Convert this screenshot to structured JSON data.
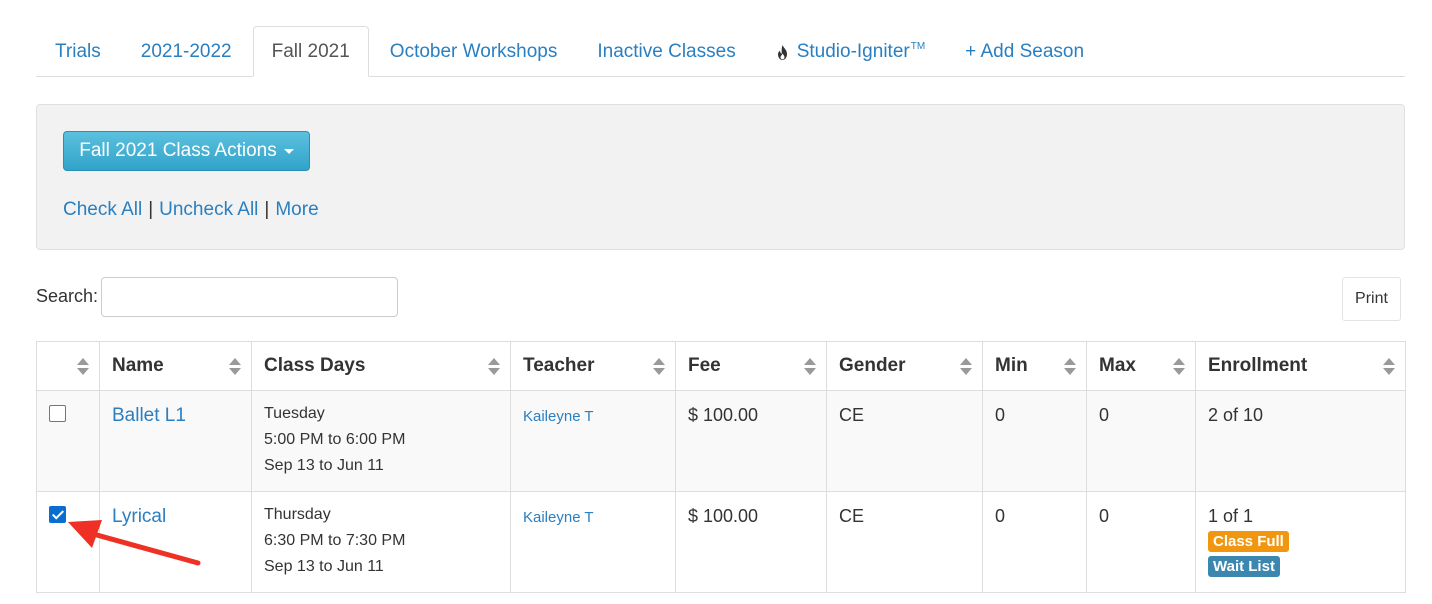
{
  "tabs": [
    {
      "label": "Trials"
    },
    {
      "label": "2021-2022"
    },
    {
      "label": "Fall 2021",
      "active": true
    },
    {
      "label": "October Workshops"
    },
    {
      "label": "Inactive Classes"
    },
    {
      "label": "Studio-Igniter",
      "icon": "flame-icon",
      "trademark": "TM"
    },
    {
      "label": "+ Add Season"
    }
  ],
  "actions": {
    "button_label": "Fall 2021 Class Actions",
    "check_all": "Check All",
    "separator": "|",
    "uncheck_all": "Uncheck All",
    "more": "More"
  },
  "search": {
    "label": "Search:",
    "value": ""
  },
  "print_label": "Print",
  "table": {
    "headers": [
      "",
      "Name",
      "Class Days",
      "Teacher",
      "Fee",
      "Gender",
      "Min",
      "Max",
      "Enrollment"
    ],
    "rows": [
      {
        "checked": false,
        "name": "Ballet L1",
        "day": "Tuesday",
        "time": "5:00 PM to 6:00 PM",
        "dates": "Sep 13 to Jun 11",
        "teacher": "Kaileyne T",
        "fee": "$ 100.00",
        "gender": "CE",
        "min": "0",
        "max": "0",
        "enrollment": "2 of 10",
        "badges": []
      },
      {
        "checked": true,
        "name": "Lyrical",
        "day": "Thursday",
        "time": "6:30 PM to 7:30 PM",
        "dates": "Sep 13 to Jun 11",
        "teacher": "Kaileyne T",
        "fee": "$ 100.00",
        "gender": "CE",
        "min": "0",
        "max": "0",
        "enrollment": "1 of 1",
        "badges": [
          "Class Full",
          "Wait List"
        ]
      }
    ]
  },
  "colors": {
    "link": "#2a7fc1",
    "action_button": "#31a4c9",
    "badge_full": "#f0960f",
    "badge_wait": "#3c87b0",
    "annotation_arrow": "#ee3124"
  }
}
